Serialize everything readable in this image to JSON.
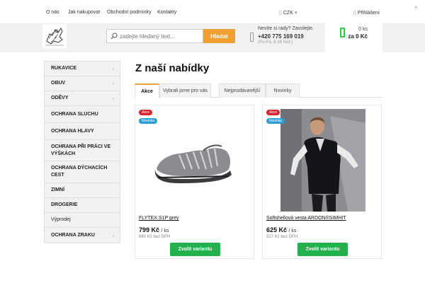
{
  "topbar": {
    "links": [
      "O nás",
      "Jak nakupovat",
      "Obchodní podmínky",
      "Kontakty"
    ],
    "currency": "CZK",
    "login": "Přihlášení"
  },
  "header": {
    "search_placeholder": "zadejte hledaný text...",
    "search_button": "Hledat",
    "help_text": "Nevíte si rady? Zavolejte.",
    "phone": "+420 775 169 019",
    "hours": "(Po-Pá, 8-16 hod.)",
    "cart_count": "0 ks",
    "cart_total": "za 0 Kč"
  },
  "sidebar": {
    "items": [
      {
        "label": "RUKAVICE",
        "arrow": true
      },
      {
        "label": "OBUV",
        "arrow": true
      },
      {
        "label": "ODĚVY",
        "arrow": true
      },
      {
        "label": "OCHRANA SLUCHU",
        "arrow": false
      },
      {
        "label": "OCHRANA HLAVY",
        "arrow": false
      },
      {
        "label": "OCHRANA PŘI PRÁCI VE VÝŠKÁCH",
        "arrow": false
      },
      {
        "label": "OCHRANA DÝCHACÍCH CEST",
        "arrow": false
      },
      {
        "label": "ZIMNÍ",
        "arrow": false
      },
      {
        "label": "DROGERIE",
        "arrow": false
      },
      {
        "label": "Výprodej",
        "arrow": false
      },
      {
        "label": "OCHRANA ZRAKU",
        "arrow": true
      }
    ]
  },
  "main": {
    "title": "Z naší nabídky",
    "tabs": [
      "Akce",
      "Vybrali jsme pro vás",
      "Nejprodávanější",
      "Novinky"
    ],
    "products": [
      {
        "badge_sale": "Akce",
        "badge_new": "Novinka",
        "name": "FLYTEX S1P grey",
        "price": "799 Kč",
        "unit": "/ ks",
        "price_net": "660 Kč bez DPH",
        "button": "Zvolit variantu"
      },
      {
        "badge_sale": "Akce",
        "badge_new": "Novinka",
        "name": "Softshellová vesta ARDON®SIMHIT",
        "price": "625 Kč",
        "unit": "/ ks",
        "price_net": "517 Kč bez DPH",
        "button": "Zvolit variantu"
      }
    ]
  },
  "colors": {
    "accent": "#f0a030",
    "cta": "#22b14c",
    "sale": "#d9232e",
    "new": "#2a9fd8"
  }
}
